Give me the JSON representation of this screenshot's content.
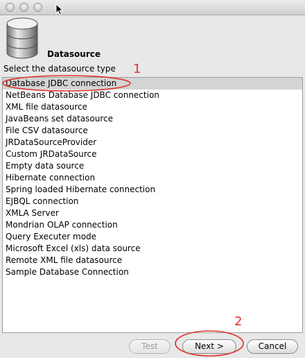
{
  "window": {
    "controls": [
      "close",
      "minimize",
      "zoom"
    ]
  },
  "header": {
    "title": "Datasource",
    "icon": "database-icon"
  },
  "section": {
    "label": "Select the datasource type"
  },
  "annotations": {
    "first": "1",
    "second": "2",
    "color": "#e0322a"
  },
  "datasource_types": [
    {
      "label": "Database JDBC connection",
      "selected": true
    },
    {
      "label": "NetBeans Database JDBC connection"
    },
    {
      "label": "XML file datasource"
    },
    {
      "label": "JavaBeans set datasource"
    },
    {
      "label": "File CSV datasource"
    },
    {
      "label": "JRDataSourceProvider"
    },
    {
      "label": "Custom JRDataSource"
    },
    {
      "label": "Empty data source"
    },
    {
      "label": "Hibernate connection"
    },
    {
      "label": "Spring loaded Hibernate connection"
    },
    {
      "label": "EJBQL connection"
    },
    {
      "label": "XMLA Server"
    },
    {
      "label": "Mondrian OLAP connection"
    },
    {
      "label": "Query Executer mode"
    },
    {
      "label": "Microsoft Excel (xls) data source"
    },
    {
      "label": "Remote XML file datasource"
    },
    {
      "label": "Sample Database Connection"
    }
  ],
  "buttons": {
    "test": {
      "label": "Test",
      "enabled": false
    },
    "next": {
      "label": "Next >",
      "enabled": true
    },
    "cancel": {
      "label": "Cancel",
      "enabled": true
    }
  }
}
